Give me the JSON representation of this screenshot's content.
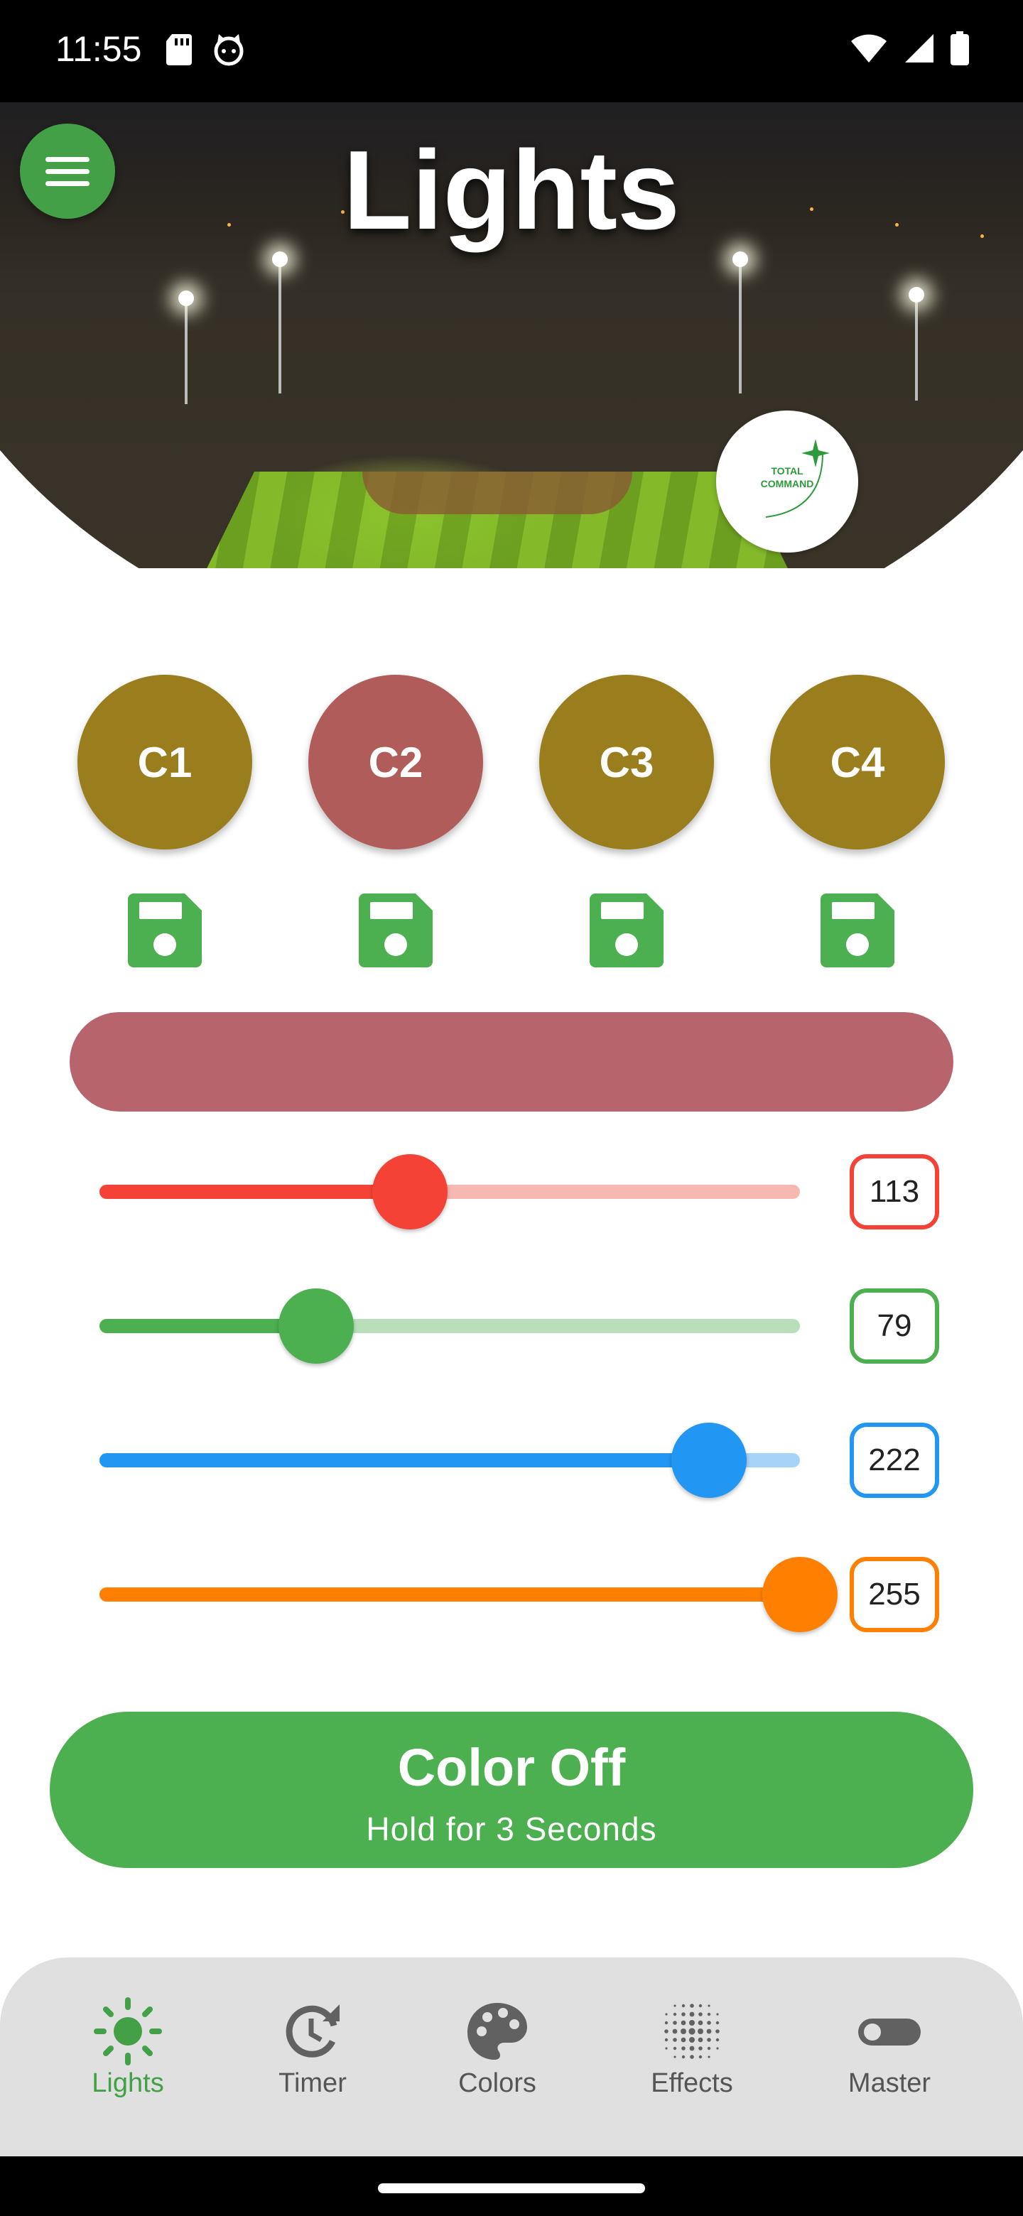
{
  "status_bar": {
    "time": "11:55",
    "left_icons": [
      "sd-card-icon",
      "cat-face-icon"
    ],
    "right_icons": [
      "wifi-icon",
      "signal-icon",
      "battery-icon"
    ]
  },
  "header": {
    "title": "Lights",
    "menu_icon": "hamburger-menu-icon",
    "logo_text": "TOTAL\nCOMMAND",
    "brand_color": "#43a047"
  },
  "channels": [
    {
      "label": "C1",
      "color": "#9a7d1c",
      "save_icon": "floppy-disk-icon"
    },
    {
      "label": "C2",
      "color": "#b05c5a",
      "save_icon": "floppy-disk-icon"
    },
    {
      "label": "C3",
      "color": "#9a7d1c",
      "save_icon": "floppy-disk-icon"
    },
    {
      "label": "C4",
      "color": "#9a7d1c",
      "save_icon": "floppy-disk-icon"
    }
  ],
  "preview_color": "#b8646c",
  "sliders": [
    {
      "name": "red",
      "value": "113",
      "max": 255,
      "color": "#f44336",
      "inactive_color": "#f8b8b2"
    },
    {
      "name": "green",
      "value": "79",
      "max": 255,
      "color": "#4caf50",
      "inactive_color": "#b9dfba"
    },
    {
      "name": "blue",
      "value": "222",
      "max": 255,
      "color": "#2196f3",
      "inactive_color": "#a7d3f8"
    },
    {
      "name": "amber",
      "value": "255",
      "max": 255,
      "color": "#ff8000",
      "inactive_color": "#ffc58a"
    }
  ],
  "color_off_button": {
    "title": "Color Off",
    "subtitle": "Hold for 3 Seconds"
  },
  "bottom_nav": {
    "active_color": "#43a047",
    "items": [
      {
        "label": "Lights",
        "icon": "sun-icon",
        "active": true
      },
      {
        "label": "Timer",
        "icon": "clock-restore-icon",
        "active": false
      },
      {
        "label": "Colors",
        "icon": "palette-icon",
        "active": false
      },
      {
        "label": "Effects",
        "icon": "dot-grid-icon",
        "active": false
      },
      {
        "label": "Master",
        "icon": "toggle-switch-icon",
        "active": false
      }
    ]
  }
}
